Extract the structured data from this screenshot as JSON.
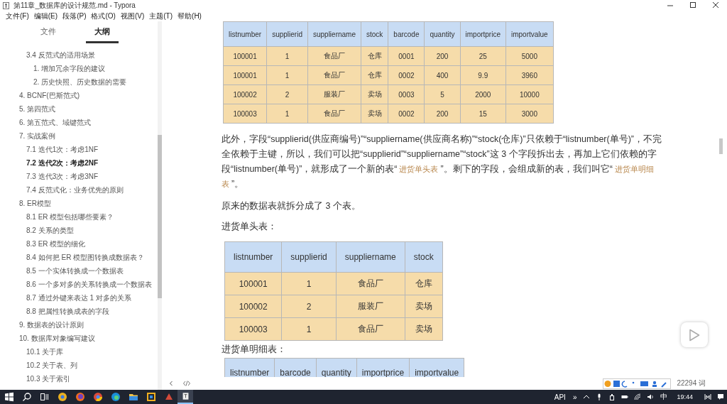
{
  "window": {
    "title": "第11章_数据库的设计规范.md - Typora"
  },
  "menu": [
    "文件(F)",
    "编辑(E)",
    "段落(P)",
    "格式(O)",
    "视图(V)",
    "主题(T)",
    "帮助(H)"
  ],
  "sidebar": {
    "tabs": [
      {
        "label": "文件",
        "selected": false
      },
      {
        "label": "大纲",
        "selected": true
      }
    ],
    "outline_continued": [
      {
        "label": "3.4 反范式的适用场景",
        "selected": false,
        "children": [
          {
            "label": "1. 增加冗余字段的建议",
            "selected": false
          },
          {
            "label": "2. 历史快照、历史数据的需要",
            "selected": false
          }
        ]
      }
    ],
    "outline": [
      {
        "label": "4. BCNF(巴斯范式)",
        "selected": false
      },
      {
        "label": "5. 第四范式",
        "selected": false
      },
      {
        "label": "6. 第五范式、域键范式",
        "selected": false
      },
      {
        "label": "7. 实战案例",
        "selected": false,
        "children": [
          {
            "label": "7.1 迭代1次：考虑1NF",
            "selected": false
          },
          {
            "label": "7.2 迭代2次：考虑2NF",
            "selected": true
          },
          {
            "label": "7.3 迭代3次：考虑3NF",
            "selected": false
          },
          {
            "label": "7.4 反范式化：业务优先的原则",
            "selected": false
          }
        ]
      },
      {
        "label": "8. ER模型",
        "selected": false,
        "children": [
          {
            "label": "8.1 ER 模型包括哪些要素？",
            "selected": false
          },
          {
            "label": "8.2 关系的类型",
            "selected": false
          },
          {
            "label": "8.3 ER 模型的细化",
            "selected": false
          },
          {
            "label": "8.4 如何把 ER 模型图转换成数据表？",
            "selected": false
          },
          {
            "label": "8.5 一个实体转换成一个数据表",
            "selected": false
          },
          {
            "label": "8.6 一个多对多的关系转换成一个数据表",
            "selected": false
          },
          {
            "label": "8.7 通过外键来表达 1 对多的关系",
            "selected": false
          },
          {
            "label": "8.8 把属性转换成表的字段",
            "selected": false
          }
        ]
      },
      {
        "label": "9. 数据表的设计原则",
        "selected": false
      },
      {
        "label": "10. 数据库对象编写建议",
        "selected": false,
        "children": [
          {
            "label": "10.1 关于库",
            "selected": false
          },
          {
            "label": "10.2 关于表、列",
            "selected": false
          },
          {
            "label": "10.3 关于索引",
            "selected": false
          }
        ]
      }
    ]
  },
  "document": [
    {
      "kind": "table",
      "columns": [
        "listnumber",
        "supplierid",
        "suppliername",
        "stock",
        "barcode",
        "quantity",
        "importprice",
        "importvalue"
      ],
      "rows": [
        [
          "100001",
          "1",
          "食品厂",
          "仓库",
          "0001",
          "200",
          "25",
          "5000"
        ],
        [
          "100001",
          "1",
          "食品厂",
          "仓库",
          "0002",
          "400",
          "9.9",
          "3960"
        ],
        [
          "100002",
          "2",
          "服装厂",
          "卖场",
          "0003",
          "5",
          "2000",
          "10000"
        ],
        [
          "100003",
          "1",
          "食品厂",
          "卖场",
          "0002",
          "200",
          "15",
          "3000"
        ]
      ]
    },
    {
      "kind": "paragraph",
      "segments": [
        {
          "kind": "plain",
          "text": "此外，字段“supplierid(供应商编号)”“suppliername(供应商名称)”“stock(仓库)”只依赖于“listnumber(单号)”，不完全依赖于主键，所以，我们可以把“supplierid”“suppliername”“stock”这 3 个字段拆出去，再加上它们依赖的字段“listnumber(单号)”，就形成了一个新的表“"
        },
        {
          "kind": "highlight",
          "text": "进货单头表"
        },
        {
          "kind": "plain",
          "text": "”。剩下的字段，会组成新的表，我们叫它“"
        },
        {
          "kind": "highlight",
          "text": "进货单明细表"
        },
        {
          "kind": "plain",
          "text": "”。"
        }
      ]
    },
    {
      "kind": "paragraph",
      "segments": [
        {
          "kind": "plain",
          "text": "原来的数据表就拆分成了 3 个表。"
        }
      ]
    },
    {
      "kind": "label",
      "text": "进货单头表："
    },
    {
      "kind": "table",
      "columns": [
        "listnumber",
        "supplierid",
        "suppliername",
        "stock"
      ],
      "rows": [
        [
          "100001",
          "1",
          "食品厂",
          "仓库"
        ],
        [
          "100002",
          "2",
          "服装厂",
          "卖场"
        ],
        [
          "100003",
          "1",
          "食品厂",
          "卖场"
        ]
      ]
    },
    {
      "kind": "label",
      "text": "进货单明细表："
    },
    {
      "kind": "table",
      "columns": [
        "listnumber",
        "barcode",
        "quantity",
        "importprice",
        "importvalue"
      ]
    }
  ],
  "status_bar": {
    "word_count": "22294 词"
  },
  "taskbar": {
    "tray": [
      "API",
      "»",
      "中"
    ],
    "clock": "19:44"
  }
}
